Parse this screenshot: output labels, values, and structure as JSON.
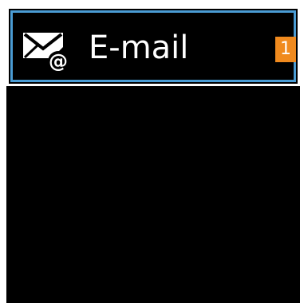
{
  "app_list": {
    "items": [
      {
        "label": "E-mail",
        "icon": "email-at-icon",
        "badge_count": "1",
        "selected": true
      }
    ]
  },
  "colors": {
    "background": "#000000",
    "selection_border": "#4a9cd4",
    "badge": "#f08a1e",
    "text": "#ffffff"
  }
}
